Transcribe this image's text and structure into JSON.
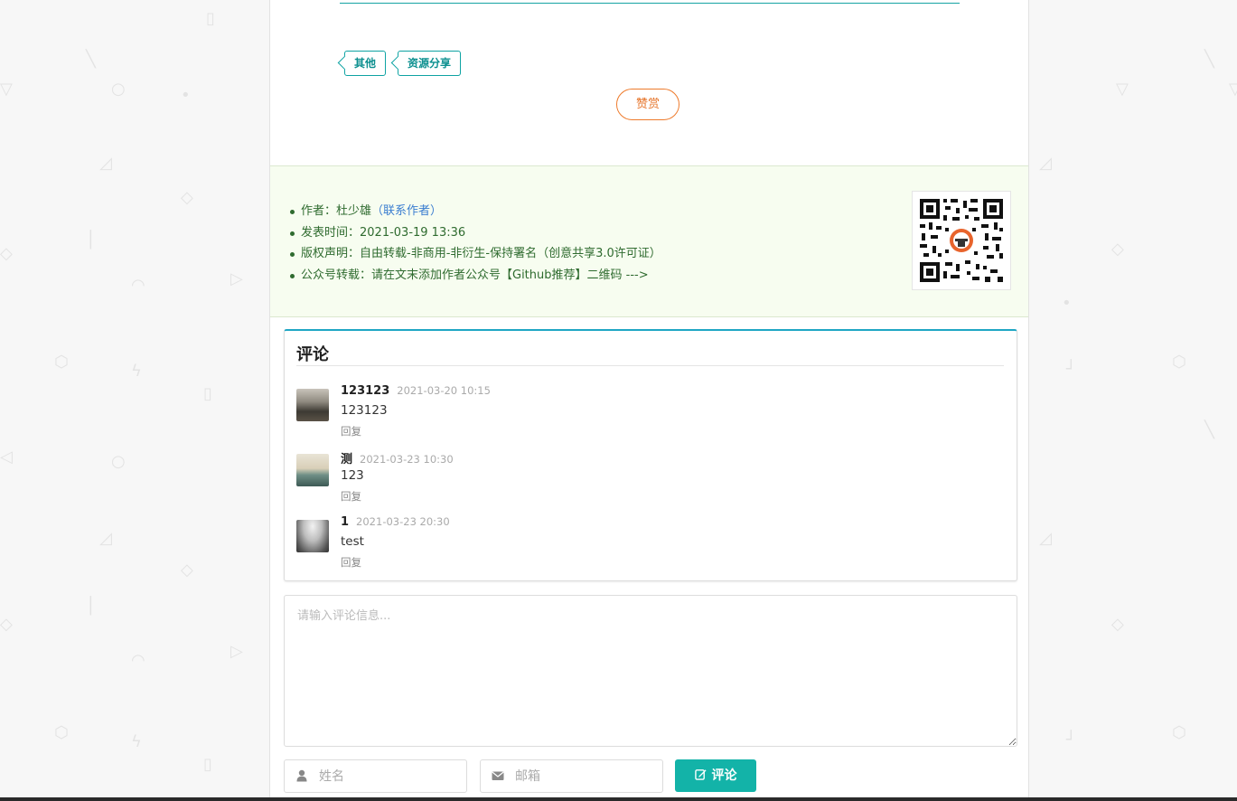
{
  "tags": [
    "其他",
    "资源分享"
  ],
  "reward_label": "赞赏",
  "info": {
    "author_label": "作者：",
    "author_name": "杜少雄",
    "contact_link": "（联系作者）",
    "publish_time": "发表时间：2021-03-19 13:36",
    "copyright": "版权声明：自由转载-非商用-非衍生-保持署名（创意共享3.0许可证）",
    "wechat_note": "公众号转载：请在文末添加作者公众号【Github推荐】二维码 --->"
  },
  "comments": {
    "title": "评论",
    "items": [
      {
        "name": "123123",
        "time": "2021-03-20 10:15",
        "text": "123123",
        "reply": "回复"
      },
      {
        "name": "测",
        "time": "2021-03-23 10:30",
        "text": "123",
        "reply": "回复"
      },
      {
        "name": "1",
        "time": "2021-03-23 20:30",
        "text": "test",
        "reply": "回复"
      }
    ]
  },
  "form": {
    "content_placeholder": "请输入评论信息...",
    "name_placeholder": "姓名",
    "email_placeholder": "邮箱",
    "submit_label": "评论"
  },
  "colors": {
    "accent": "#13b3a8",
    "tag": "#0ea3a3",
    "reward": "#ee7b2c"
  }
}
